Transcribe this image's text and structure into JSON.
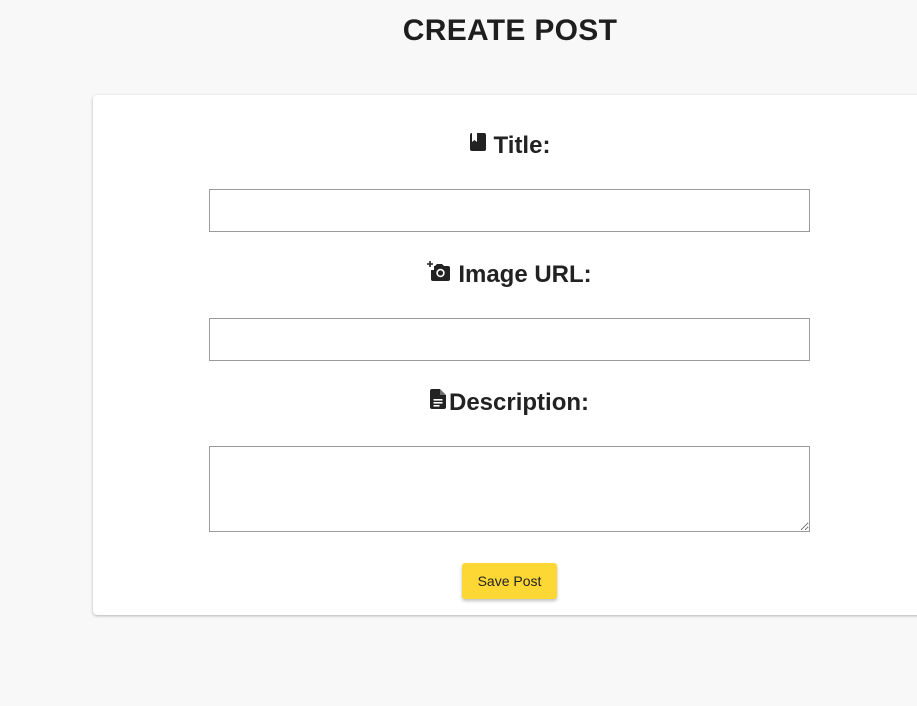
{
  "page": {
    "title": "CREATE POST"
  },
  "form": {
    "title_field": {
      "label": "Title:",
      "icon": "book-icon",
      "value": "",
      "placeholder": ""
    },
    "image_field": {
      "label": "Image URL:",
      "icon": "add-a-photo-icon",
      "value": "",
      "placeholder": ""
    },
    "description_field": {
      "label": "Description:",
      "icon": "description-icon",
      "value": "",
      "placeholder": ""
    },
    "save_label": "Save Post"
  },
  "colors": {
    "background": "#f8f8f8",
    "card": "#ffffff",
    "button": "#fdd835",
    "text": "#222222",
    "input_border": "#9a9a9a"
  }
}
